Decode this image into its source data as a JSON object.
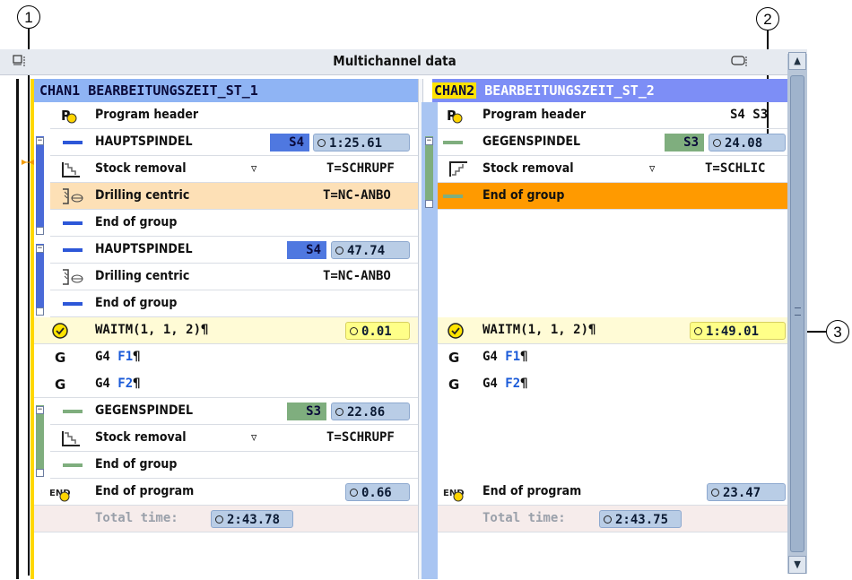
{
  "window_title": "Multichannel data",
  "callouts": [
    "1",
    "2",
    "3"
  ],
  "chan1": {
    "header_chan": "CHAN1",
    "header_program": "BEARBEITUNGSZEIT_ST_1",
    "rows": [
      {
        "text": "Program header"
      },
      {
        "text": "HAUPTSPINDEL",
        "spindle": "S4",
        "time": "1:25.61"
      },
      {
        "text": "Stock removal",
        "arrow": "▿",
        "tool": "T=SCHRUPF"
      },
      {
        "text": "Drilling centric",
        "tool": "T=NC-ANBO"
      },
      {
        "text": "End of group"
      },
      {
        "text": "HAUPTSPINDEL",
        "spindle": "S4",
        "time": "47.74"
      },
      {
        "text": "Drilling centric",
        "tool": "T=NC-ANBO"
      },
      {
        "text": "End of group"
      },
      {
        "text": "WAITM(1, 1, 2)¶",
        "time": "0.01"
      },
      {
        "prefix": "G4",
        "arg": "F1",
        "mark": "¶"
      },
      {
        "prefix": "G4",
        "arg": "F2",
        "mark": "¶"
      },
      {
        "text": "GEGENSPINDEL",
        "spindle": "S3",
        "time": "22.86"
      },
      {
        "text": "Stock removal",
        "arrow": "▿",
        "tool": "T=SCHRUPF"
      },
      {
        "text": "End of group"
      },
      {
        "text": "End of program",
        "time": "0.66"
      }
    ],
    "total_label": "Total time:",
    "total_time": "2:43.78"
  },
  "chan2": {
    "header_chan": "CHAN2",
    "header_program": "BEARBEITUNGSZEIT_ST_2",
    "rows": [
      {
        "text": "Program header",
        "spindles": "S4 S3"
      },
      {
        "text": "GEGENSPINDEL",
        "spindle": "S3",
        "time": "24.08"
      },
      {
        "text": "Stock removal",
        "arrow": "▿",
        "tool": "T=SCHLIC"
      },
      {
        "text": "End of group"
      },
      {
        "text": "WAITM(1, 1, 2)¶",
        "time": "1:49.01"
      },
      {
        "prefix": "G4",
        "arg": "F1",
        "mark": "¶"
      },
      {
        "prefix": "G4",
        "arg": "F2",
        "mark": "¶"
      },
      {
        "text": "End of program",
        "time": "23.47"
      }
    ],
    "total_label": "Total time:",
    "total_time": "2:43.75"
  },
  "icons": {
    "program_header": "program-header-icon",
    "spindle": "spindle-dash-icon",
    "stock_removal": "stock-removal-icon",
    "drilling": "drilling-icon",
    "wait": "clock-icon",
    "g_code": "G",
    "end_program": "END"
  },
  "colors": {
    "header_blue": "#7fa9f0",
    "chan2_highlight": "#ffe200",
    "s4_badge": "#4f78e0",
    "s3_badge": "#7fae7e",
    "selected_row": "#fde0b6",
    "active_row": "#ff9a00",
    "wait_row": "#fffbd6",
    "total_row": "#f6eceb"
  }
}
